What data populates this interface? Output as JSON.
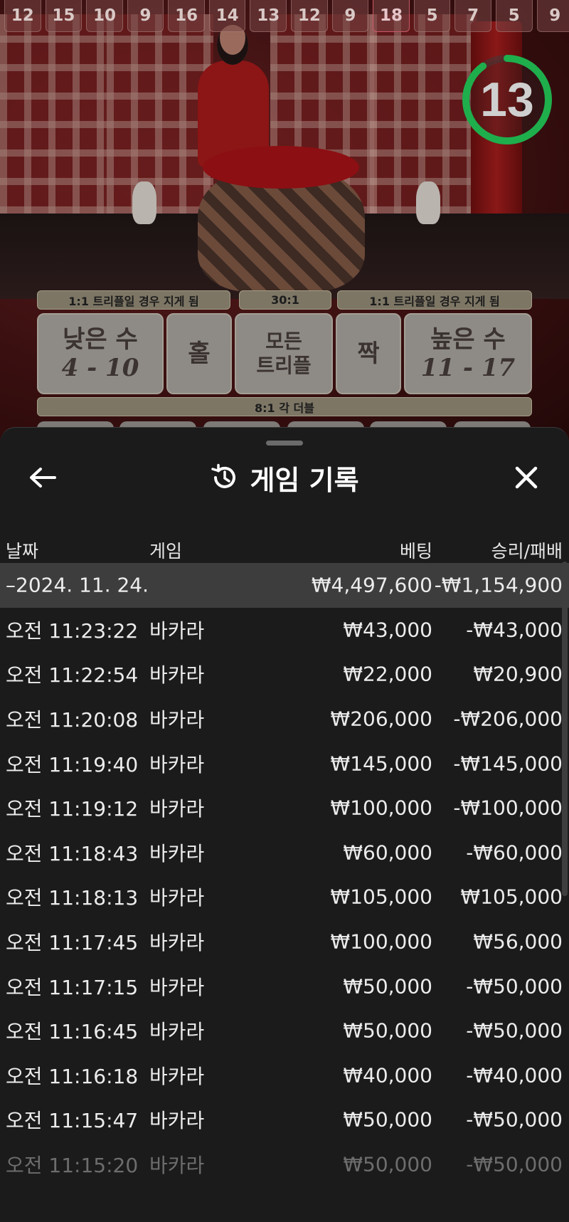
{
  "history_numbers": [
    "12",
    "15",
    "10",
    "9",
    "16",
    "14",
    "13",
    "12",
    "9",
    "18",
    "5",
    "7",
    "5",
    "9"
  ],
  "highlighted_index": 9,
  "timer": {
    "value": "13",
    "progress": 0.9,
    "color": "#1fae4c"
  },
  "betting_board": {
    "top_strip_left": "1:1 트리플일 경우 지게 됨",
    "top_strip_center": "30:1",
    "top_strip_right": "1:1 트리플일 경우 지게 됨",
    "low": {
      "label": "낮은 수",
      "range": "4 - 10"
    },
    "odd": {
      "label": "홀"
    },
    "any_triple": {
      "line1": "모든",
      "line2": "트리플"
    },
    "even": {
      "label": "짝"
    },
    "high": {
      "label": "높은 수",
      "range": "11 - 17"
    },
    "bottom_strip": "8:1 각 더블"
  },
  "sheet": {
    "title": "게임 기록",
    "back_icon": "arrow-left-icon",
    "title_icon": "history-icon",
    "close_icon": "close-icon"
  },
  "table": {
    "headers": {
      "date": "날짜",
      "game": "게임",
      "bet": "베팅",
      "win_loss": "승리/패배"
    },
    "group": {
      "date": "–2024. 11. 24.",
      "bet": "₩4,497,600",
      "win_loss": "-₩1,154,900"
    },
    "rows": [
      {
        "time": "오전 11:23:22",
        "game": "바카라",
        "bet": "₩43,000",
        "win_loss": "-₩43,000"
      },
      {
        "time": "오전 11:22:54",
        "game": "바카라",
        "bet": "₩22,000",
        "win_loss": "₩20,900"
      },
      {
        "time": "오전 11:20:08",
        "game": "바카라",
        "bet": "₩206,000",
        "win_loss": "-₩206,000"
      },
      {
        "time": "오전 11:19:40",
        "game": "바카라",
        "bet": "₩145,000",
        "win_loss": "-₩145,000"
      },
      {
        "time": "오전 11:19:12",
        "game": "바카라",
        "bet": "₩100,000",
        "win_loss": "-₩100,000"
      },
      {
        "time": "오전 11:18:43",
        "game": "바카라",
        "bet": "₩60,000",
        "win_loss": "-₩60,000"
      },
      {
        "time": "오전 11:18:13",
        "game": "바카라",
        "bet": "₩105,000",
        "win_loss": "₩105,000"
      },
      {
        "time": "오전 11:17:45",
        "game": "바카라",
        "bet": "₩100,000",
        "win_loss": "₩56,000"
      },
      {
        "time": "오전 11:17:15",
        "game": "바카라",
        "bet": "₩50,000",
        "win_loss": "-₩50,000"
      },
      {
        "time": "오전 11:16:45",
        "game": "바카라",
        "bet": "₩50,000",
        "win_loss": "-₩50,000"
      },
      {
        "time": "오전 11:16:18",
        "game": "바카라",
        "bet": "₩40,000",
        "win_loss": "-₩40,000"
      },
      {
        "time": "오전 11:15:47",
        "game": "바카라",
        "bet": "₩50,000",
        "win_loss": "-₩50,000"
      },
      {
        "time": "오전 11:15:20",
        "game": "바카라",
        "bet": "₩50,000",
        "win_loss": "-₩50,000"
      }
    ]
  }
}
